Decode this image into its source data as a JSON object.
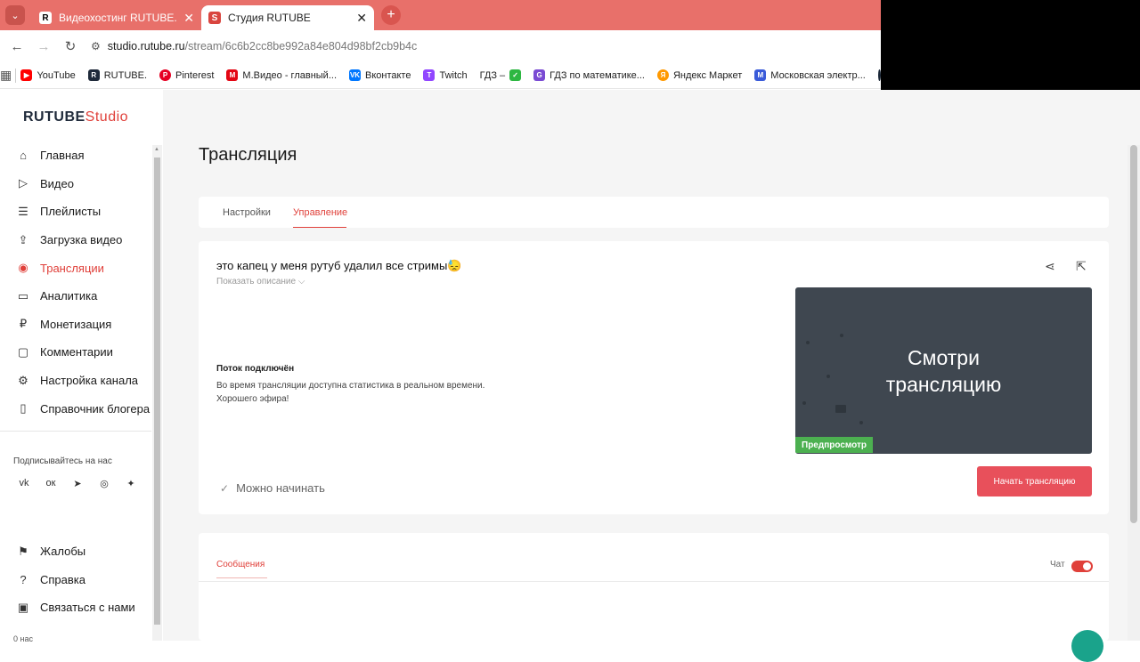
{
  "browser": {
    "tabs": [
      {
        "title": "Видеохостинг RUTUBE. Смотри",
        "favicon": "R"
      },
      {
        "title": "Студия RUTUBE",
        "favicon": "S"
      }
    ],
    "url_host": "studio.rutube.ru",
    "url_path": "/stream/6c6b2cc8be992a84e804d98bf2cb9b4c",
    "bookmarks": [
      {
        "label": "YouTube",
        "color": "#ff0000"
      },
      {
        "label": "RUTUBE.",
        "color": "#1f2a3a"
      },
      {
        "label": "Pinterest",
        "color": "#e60023"
      },
      {
        "label": "М.Видео - главный...",
        "color": "#e30613"
      },
      {
        "label": "Вконтакте",
        "color": "#0077ff"
      },
      {
        "label": "Twitch",
        "color": "#9146ff"
      },
      {
        "label": "ГДЗ –",
        "color": "#2db742"
      },
      {
        "label": "ГДЗ по математике...",
        "color": "#7a4bd3"
      },
      {
        "label": "Яндекс Маркет",
        "color": "#ffcc00"
      },
      {
        "label": "Московская электр...",
        "color": "#3a5bd9"
      }
    ]
  },
  "sidebar": {
    "logo_main": "RUTUBE",
    "logo_studio": "Studio",
    "items": [
      {
        "label": "Главная",
        "icon": "home-icon"
      },
      {
        "label": "Видео",
        "icon": "video-icon"
      },
      {
        "label": "Плейлисты",
        "icon": "playlist-icon"
      },
      {
        "label": "Загрузка видео",
        "icon": "upload-icon"
      },
      {
        "label": "Трансляции",
        "icon": "broadcast-icon"
      },
      {
        "label": "Аналитика",
        "icon": "analytics-icon"
      },
      {
        "label": "Монетизация",
        "icon": "ruble-icon"
      },
      {
        "label": "Комментарии",
        "icon": "comment-icon"
      },
      {
        "label": "Настройка канала",
        "icon": "gear-icon"
      },
      {
        "label": "Справочник блогера",
        "icon": "book-icon"
      }
    ],
    "follow_label": "Подписывайтесь на нас",
    "bottom_items": [
      {
        "label": "Жалобы",
        "icon": "flag-icon"
      },
      {
        "label": "Справка",
        "icon": "help-icon"
      },
      {
        "label": "Связаться с нами",
        "icon": "chat-icon"
      }
    ],
    "time_ago": "0 нас"
  },
  "main": {
    "page_title": "Трансляция",
    "tabs": [
      "Настройки",
      "Управление"
    ],
    "stream": {
      "title": "это капец у меня рутуб удалил все стримы😓",
      "show_description": "Показать описание ⌵",
      "connected_title": "Поток подключён",
      "connected_text_1": "Во время трансляции доступна статистика в реальном времени.",
      "connected_text_2": "Хорошего эфира!",
      "preview_text_1": "Смотри",
      "preview_text_2": "трансляцию",
      "preview_badge": "Предпросмотр",
      "ready_label": "Можно начинать",
      "start_button": "Начать трансляцию"
    },
    "chat": {
      "messages_tab": "Сообщения",
      "chat_label": "Чат"
    }
  }
}
